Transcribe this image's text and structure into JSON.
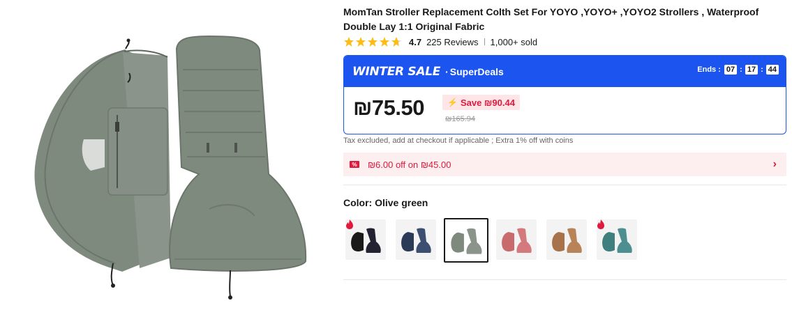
{
  "product": {
    "title": "MomTan Stroller Replacement Colth Set For YOYO ,YOYO+ ,YOYO2 Strollers , Waterproof Double Lay 1:1 Original Fabric",
    "rating": "4.7",
    "reviews": "225 Reviews",
    "sold": "1,000+ sold",
    "stars": [
      "star-full-icon",
      "star-full-icon",
      "star-full-icon",
      "star-full-icon",
      "star-half-icon"
    ]
  },
  "sale": {
    "title": "WINTER SALE",
    "dot": "·",
    "subtitle": "SuperDeals",
    "ends_label": "Ends :",
    "timer": {
      "hours": "07",
      "minutes": "17",
      "seconds": "44",
      "sep": ":"
    },
    "price": "₪75.50",
    "save": "Save ₪90.44",
    "original_price": "₪165.94",
    "accent_color": "#1c54ef"
  },
  "tax_note": "Tax excluded, add at checkout if applicable ; Extra 1% off with coins",
  "coupon": {
    "icon": "%",
    "text": "₪6.00 off on ₪45.00",
    "chevron": "›",
    "color": "#e1193c"
  },
  "color_option": {
    "label": "Color: Olive green",
    "swatches": [
      {
        "name": "black",
        "hot": true,
        "selected": false
      },
      {
        "name": "navy",
        "hot": false,
        "selected": false
      },
      {
        "name": "olive-green",
        "hot": false,
        "selected": true
      },
      {
        "name": "pink",
        "hot": false,
        "selected": false
      },
      {
        "name": "caramel",
        "hot": false,
        "selected": false
      },
      {
        "name": "teal",
        "hot": true,
        "selected": false
      }
    ]
  }
}
